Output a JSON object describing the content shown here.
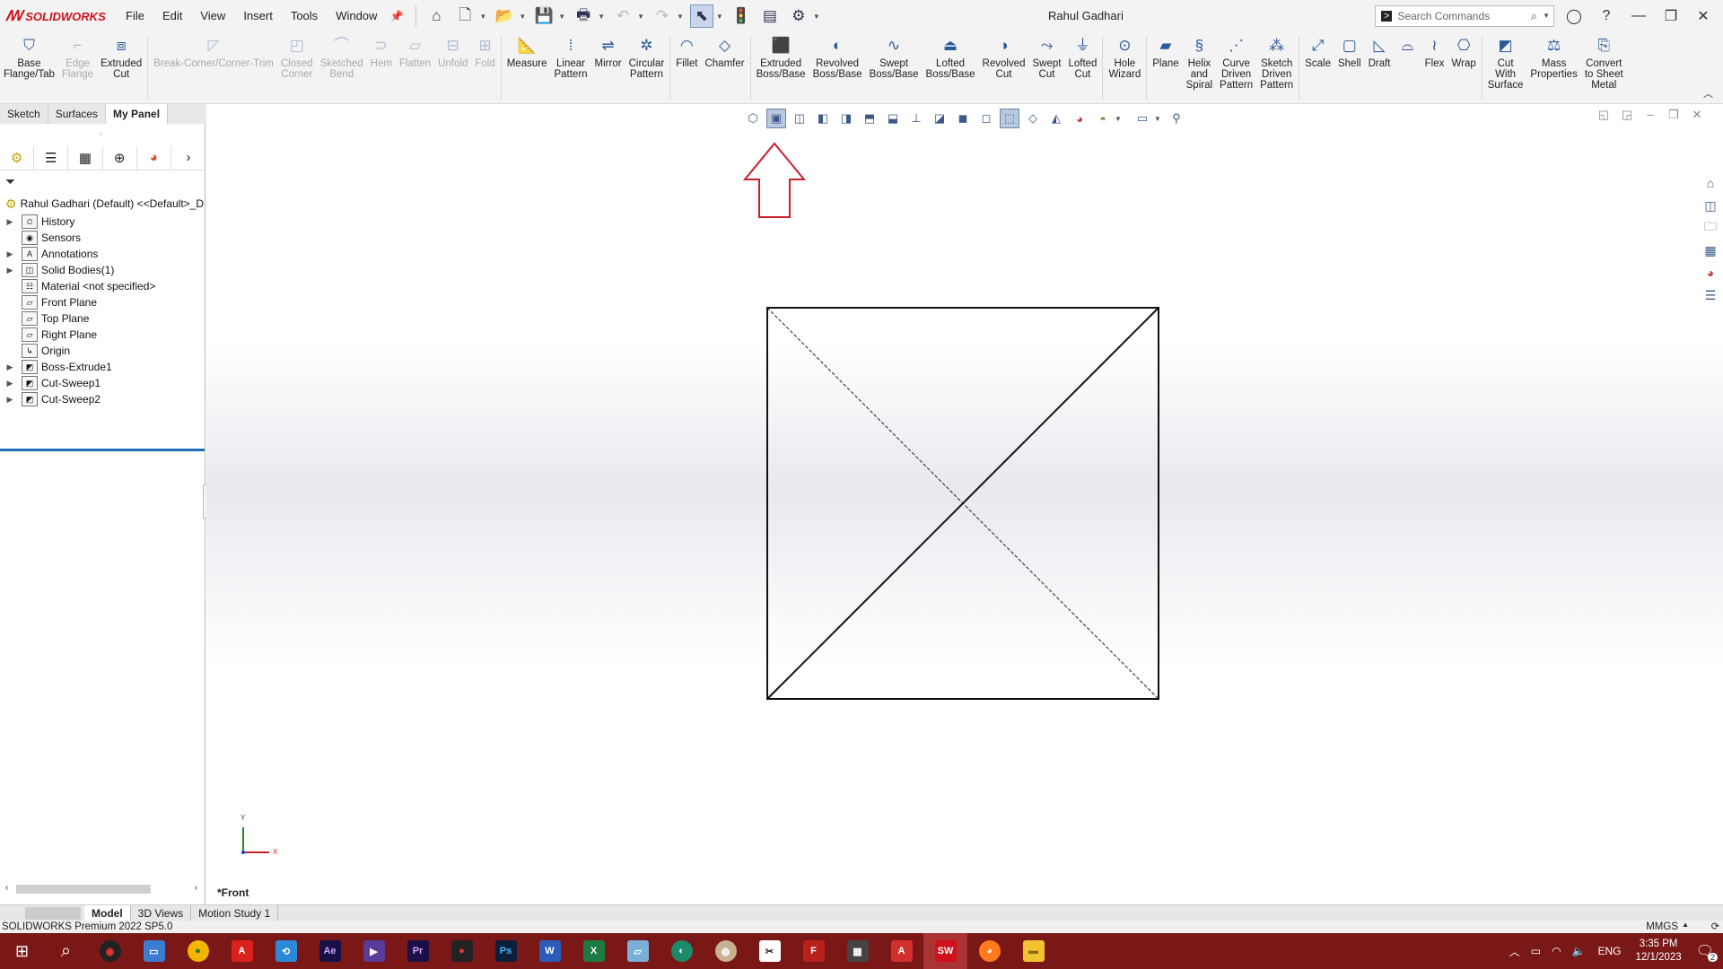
{
  "app": {
    "brand_ds": "𝔇𝔖",
    "brand": "SOLIDWORKS",
    "document_title": "Rahul Gadhari"
  },
  "menu": [
    "File",
    "Edit",
    "View",
    "Insert",
    "Tools",
    "Window"
  ],
  "search": {
    "placeholder": "Search Commands"
  },
  "ribbon": {
    "tools": [
      {
        "label": "Base\nFlange/Tab",
        "enabled": true,
        "icon": "base-flange-icon"
      },
      {
        "label": "Edge\nFlange",
        "enabled": false,
        "icon": "edge-flange-icon"
      },
      {
        "label": "Extruded\nCut",
        "enabled": true,
        "icon": "extruded-cut-icon"
      },
      {
        "label": "Break-Corner/Corner-Trim",
        "enabled": false,
        "icon": "break-corner-icon"
      },
      {
        "label": "Closed\nCorner",
        "enabled": false,
        "icon": "closed-corner-icon"
      },
      {
        "label": "Sketched\nBend",
        "enabled": false,
        "icon": "sketched-bend-icon"
      },
      {
        "label": "Hem",
        "enabled": false,
        "icon": "hem-icon"
      },
      {
        "label": "Flatten",
        "enabled": false,
        "icon": "flatten-icon"
      },
      {
        "label": "Unfold",
        "enabled": false,
        "icon": "unfold-icon"
      },
      {
        "label": "Fold",
        "enabled": false,
        "icon": "fold-icon"
      },
      {
        "label": "Measure",
        "enabled": true,
        "icon": "measure-icon"
      },
      {
        "label": "Linear\nPattern",
        "enabled": true,
        "icon": "linear-pattern-icon"
      },
      {
        "label": "Mirror",
        "enabled": true,
        "icon": "mirror-icon"
      },
      {
        "label": "Circular\nPattern",
        "enabled": true,
        "icon": "circular-pattern-icon"
      },
      {
        "label": "Fillet",
        "enabled": true,
        "icon": "fillet-icon"
      },
      {
        "label": "Chamfer",
        "enabled": true,
        "icon": "chamfer-icon"
      },
      {
        "label": "Extruded\nBoss/Base",
        "enabled": true,
        "icon": "extruded-boss-icon"
      },
      {
        "label": "Revolved\nBoss/Base",
        "enabled": true,
        "icon": "revolved-boss-icon"
      },
      {
        "label": "Swept\nBoss/Base",
        "enabled": true,
        "icon": "swept-boss-icon"
      },
      {
        "label": "Lofted\nBoss/Base",
        "enabled": true,
        "icon": "lofted-boss-icon"
      },
      {
        "label": "Revolved\nCut",
        "enabled": true,
        "icon": "revolved-cut-icon"
      },
      {
        "label": "Swept\nCut",
        "enabled": true,
        "icon": "swept-cut-icon"
      },
      {
        "label": "Lofted\nCut",
        "enabled": true,
        "icon": "lofted-cut-icon"
      },
      {
        "label": "Hole\nWizard",
        "enabled": true,
        "icon": "hole-wizard-icon"
      },
      {
        "label": "Plane",
        "enabled": true,
        "icon": "plane-icon"
      },
      {
        "label": "Helix\nand\nSpiral",
        "enabled": true,
        "icon": "helix-icon"
      },
      {
        "label": "Curve\nDriven\nPattern",
        "enabled": true,
        "icon": "curve-pattern-icon"
      },
      {
        "label": "Sketch\nDriven\nPattern",
        "enabled": true,
        "icon": "sketch-pattern-icon"
      },
      {
        "label": "Scale",
        "enabled": true,
        "icon": "scale-icon"
      },
      {
        "label": "Shell",
        "enabled": true,
        "icon": "shell-icon"
      },
      {
        "label": "Draft",
        "enabled": true,
        "icon": "draft-icon"
      },
      {
        "label": "",
        "enabled": true,
        "icon": "dome-icon"
      },
      {
        "label": "Flex",
        "enabled": true,
        "icon": "flex-icon"
      },
      {
        "label": "Wrap",
        "enabled": true,
        "icon": "wrap-icon"
      },
      {
        "label": "Cut\nWith\nSurface",
        "enabled": true,
        "icon": "cut-surface-icon"
      },
      {
        "label": "Mass\nProperties",
        "enabled": true,
        "icon": "mass-properties-icon"
      },
      {
        "label": "Convert\nto Sheet\nMetal",
        "enabled": true,
        "icon": "convert-sheet-metal-icon"
      }
    ]
  },
  "cm_tabs": [
    "Sketch",
    "Surfaces",
    "My Panel"
  ],
  "tree": {
    "root": "Rahul Gadhari (Default) <<Default>_D",
    "items": [
      {
        "label": "History",
        "expandable": true
      },
      {
        "label": "Sensors",
        "expandable": false
      },
      {
        "label": "Annotations",
        "expandable": true
      },
      {
        "label": "Solid Bodies(1)",
        "expandable": true
      },
      {
        "label": "Material <not specified>",
        "expandable": false
      },
      {
        "label": "Front Plane",
        "expandable": false
      },
      {
        "label": "Top Plane",
        "expandable": false
      },
      {
        "label": "Right Plane",
        "expandable": false
      },
      {
        "label": "Origin",
        "expandable": false
      },
      {
        "label": "Boss-Extrude1",
        "expandable": true
      },
      {
        "label": "Cut-Sweep1",
        "expandable": true
      },
      {
        "label": "Cut-Sweep2",
        "expandable": true
      }
    ]
  },
  "viewport": {
    "view_name": "*Front",
    "triad_y": "Y",
    "triad_x": "X",
    "annotation_color": "#c8202a"
  },
  "bottom_tabs": [
    "Model",
    "3D Views",
    "Motion Study 1"
  ],
  "status": {
    "left": "SOLIDWORKS Premium 2022 SP5.0",
    "units": "MMGS"
  },
  "taskbar": {
    "lang": "ENG",
    "time": "3:35 PM",
    "date": "12/1/2023",
    "notifications": "2"
  }
}
